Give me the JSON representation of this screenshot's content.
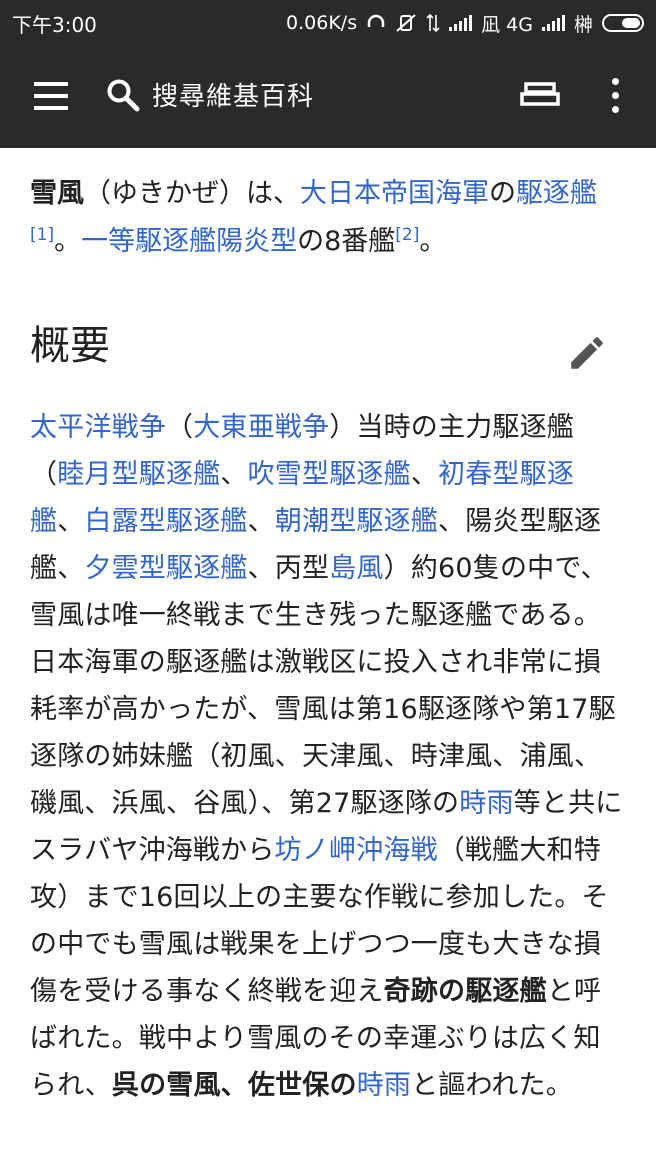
{
  "status_bar": {
    "time": "下午3:00",
    "speed": "0.06K/s",
    "network1": "凪 4G",
    "carrier2": "榊"
  },
  "toolbar": {
    "search_placeholder": "搜尋維基百科",
    "icons": [
      "menu-icon",
      "search-icon",
      "tabs-icon",
      "more-vert-icon"
    ]
  },
  "article": {
    "intro": {
      "t1": "雪風",
      "t2": "（ゆきかぜ）は、",
      "l1": "大日本帝国海軍",
      "t3": "の",
      "l2": "駆逐艦",
      "ref1": "[1]",
      "t4": "。",
      "l3": "一等駆逐艦陽炎型",
      "t5": "の8番艦",
      "ref2": "[2]",
      "t6": "。"
    },
    "section_title": "概要",
    "body": {
      "l1": "太平洋戦争",
      "t1": "（",
      "l2": "大東亜戦争",
      "t2": "）当時の主力駆逐艦（",
      "l3": "睦月型駆逐艦",
      "t3": "、",
      "l4": "吹雪型駆逐艦",
      "t4": "、",
      "l5": "初春型駆逐艦",
      "t5": "、",
      "l6": "白露型駆逐艦",
      "t6": "、",
      "l7": "朝潮型駆逐艦",
      "t7": "、陽炎型駆逐艦、",
      "l8": "夕雲型駆逐艦",
      "t8": "、丙型",
      "l9": "島風",
      "t9": "）約60隻の中で、雪風は唯一終戦まで生き残った駆逐艦である。日本海軍の駆逐艦は激戦区に投入され非常に損耗率が高かったが、雪風は第16駆逐隊や第17駆逐隊の姉妹艦（初風、天津風、時津風、浦風、磯風、浜風、谷風）、第27駆逐隊の",
      "l10": "時雨",
      "t10": "等と共にスラバヤ沖海戦から",
      "l11": "坊ノ岬沖海戦",
      "t11": "（戦艦大和特攻）まで16回以上の主要な作戦に参加した。その中でも雪風は戦果を上げつつ一度も大きな損傷を受ける事なく終戦を迎え",
      "b1": "奇跡の駆逐艦",
      "t12": "と呼ばれた。戦中より雪風のその幸運ぶりは広く知られ、",
      "b2": "呉の雪風、佐世保の",
      "l12": "時雨",
      "t13": "と謳われた。"
    }
  },
  "colors": {
    "toolbar": "#2a2a2a",
    "link": "#3366cc",
    "text": "#222222"
  }
}
